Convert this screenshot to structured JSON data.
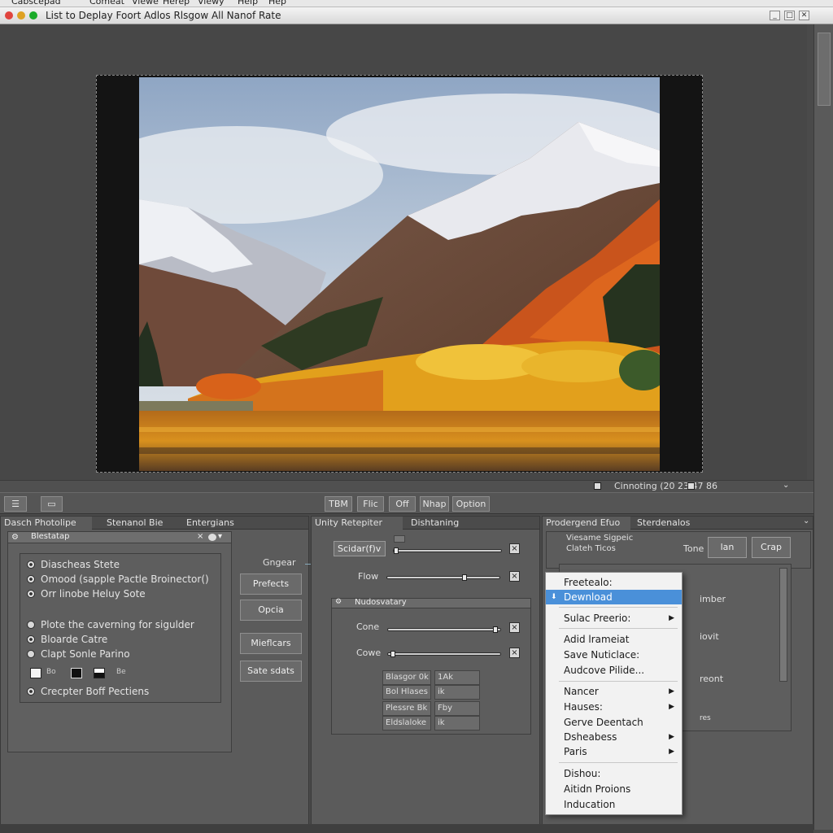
{
  "menubar": {
    "items": [
      "Cabscepad",
      "Comeat",
      "Viewe",
      "Herep",
      "Viewy",
      "Help",
      "Hep"
    ]
  },
  "titlebar": {
    "title": "List to Deplay  Foort  Adlos  Rlsgow All Nanof Rate",
    "btn_min": "_",
    "btn_max": "□",
    "btn_close": "✕"
  },
  "colors": {
    "accent": "#4a90d9",
    "traffic_red": "#e0443e",
    "traffic_yellow": "#dea123",
    "traffic_green": "#1aab29"
  },
  "status": {
    "text": "Cinnoting (20    23 47 86",
    "icon_left": "square-icon",
    "icon_mid": "square-icon",
    "icon_right": "chevron-down-icon"
  },
  "toolbar": {
    "buttons": [
      "TBM",
      "Flic",
      "Off",
      "Nhap",
      "Option"
    ]
  },
  "panel_left": {
    "tabs": [
      "Dasch Photolipe",
      "Stenanol Bie",
      "Entergians"
    ],
    "subheader": "Blestatap",
    "options_group1": [
      {
        "label": "Diascheas Stete",
        "on": true
      },
      {
        "label": "Omood (sapple Pactle Broinector()",
        "on": true
      },
      {
        "label": "Orr linobe Heluy Sote",
        "on": true
      }
    ],
    "options_group2": [
      {
        "label": "Plote the caverning for sigulder",
        "on": false
      },
      {
        "label": "Bloarde Catre",
        "on": true
      },
      {
        "label": "Clapt Sonle Parino",
        "on": false
      }
    ],
    "last_option": {
      "label": "Crecpter Boff Pectiens",
      "on": true
    },
    "swatch_small_labels": [
      "Bo",
      "Be"
    ],
    "buttons": [
      "Prefects",
      "Opcia",
      "Mieflcars",
      "Sate sdats"
    ],
    "connector_label": "Gngear"
  },
  "panel_mid": {
    "tabs": [
      "Unity Retepiter",
      "Dishtaning"
    ],
    "select_label": "Scidar(f)v",
    "flow_label": "Flow",
    "sub_panel_title": "Nudosvatary",
    "slider1_label": "Cone",
    "slider2_label": "Cowe",
    "grid_cells": [
      "Blasgor 0k",
      "1Ak",
      "Bol Hlases",
      "ik",
      "Plessre Bk",
      "Fby",
      "Eldslaloke",
      "ik"
    ],
    "flow_value": 0.7,
    "slider1_value": 0.98,
    "slider2_value": 0.02
  },
  "panel_right": {
    "tabs": [
      "Prodergend Efuo",
      "Sterdenalos"
    ],
    "header_line1": "Viesame Sigpeic",
    "header_line2": "Clateh Ticos",
    "tone_label": "Tone",
    "btn_lan": "lan",
    "btn_crop": "Crap",
    "partial_labels": [
      "imber",
      "iovit",
      "reont",
      "res"
    ]
  },
  "context_menu": {
    "items": [
      {
        "label": "Freetealo:",
        "submenu": false,
        "selected": false
      },
      {
        "label": "Dewnload",
        "submenu": false,
        "selected": true
      },
      {
        "label": "Sulac Preerio:",
        "submenu": true,
        "selected": false
      },
      {
        "label": "Adid lrameiat",
        "submenu": false,
        "selected": false
      },
      {
        "label": "Save Nuticlace:",
        "submenu": false,
        "selected": false
      },
      {
        "label": "Audcove Pilide...",
        "submenu": false,
        "selected": false
      },
      {
        "label": "Nancer",
        "submenu": true,
        "selected": false
      },
      {
        "label": "Hauses:",
        "submenu": true,
        "selected": false
      },
      {
        "label": "Gerve Deentach",
        "submenu": false,
        "selected": false
      },
      {
        "label": "Dsheabess",
        "submenu": true,
        "selected": false
      },
      {
        "label": "Paris",
        "submenu": true,
        "selected": false
      },
      {
        "label": "Dishou:",
        "submenu": false,
        "selected": false
      },
      {
        "label": "Aitidn Proions",
        "submenu": false,
        "selected": false
      },
      {
        "label": "Inducation",
        "submenu": false,
        "selected": false
      }
    ]
  }
}
